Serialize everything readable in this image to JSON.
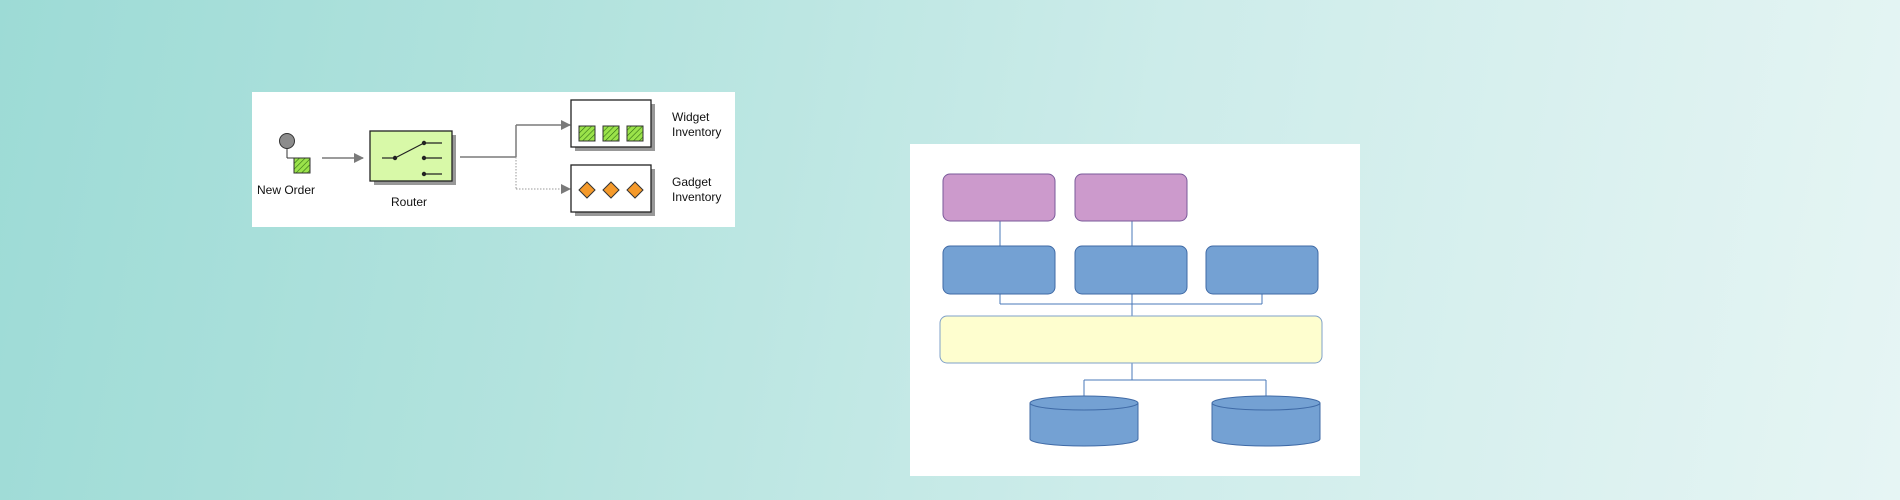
{
  "eip_diagram": {
    "new_order_label": "New Order",
    "router_label": "Router",
    "widget_label_line1": "Widget",
    "widget_label_line2": "Inventory",
    "gadget_label_line1": "Gadget",
    "gadget_label_line2": "Inventory"
  },
  "colors": {
    "item_green": "#9be34a",
    "router_fill": "#d8f9a8",
    "diamond_orange": "#f59a2b",
    "arch_purple": "#cc9acc",
    "arch_blue": "#74a1d3",
    "arch_bus_yellow": "#fefecf",
    "arch_line": "#4a78b8"
  }
}
